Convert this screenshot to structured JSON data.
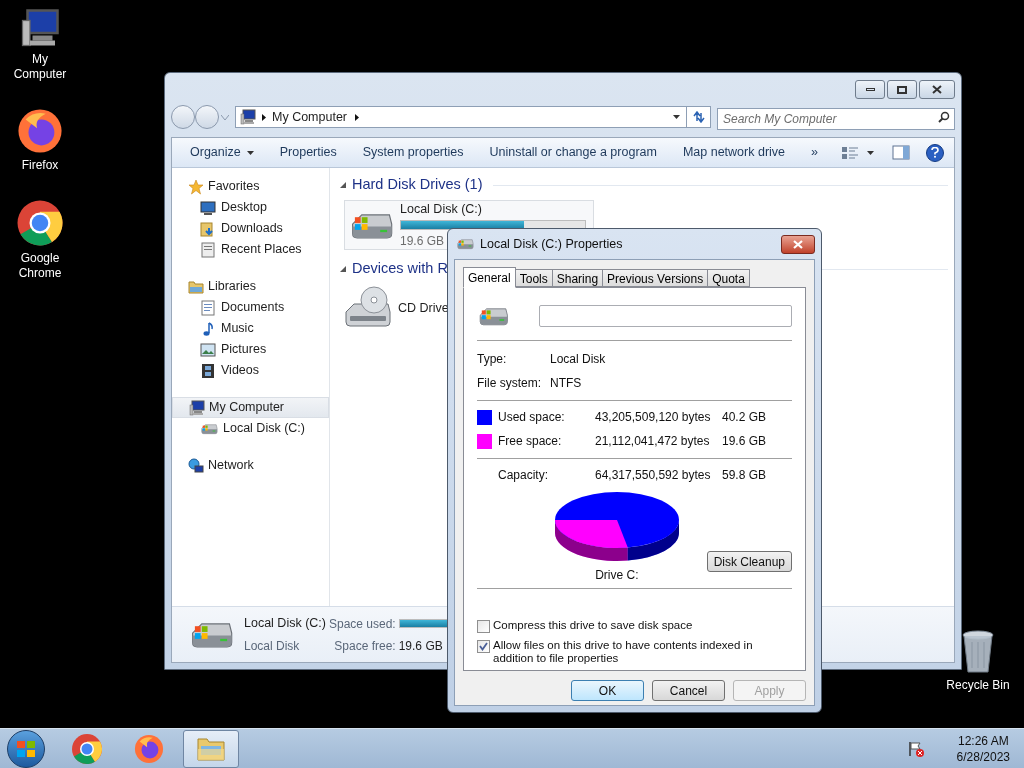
{
  "desktop": {
    "left_icons": [
      {
        "kind": "computer",
        "label": "My Computer"
      },
      {
        "kind": "firefox",
        "label": "Firefox"
      },
      {
        "kind": "chrome",
        "label": "Google Chrome"
      }
    ],
    "right_icons": [
      {
        "kind": "recycle-bin",
        "label": "Recycle Bin"
      }
    ]
  },
  "explorer": {
    "address": {
      "crumbs": [
        "My Computer"
      ]
    },
    "search": {
      "placeholder": "Search My Computer"
    },
    "toolbar": [
      {
        "kind": "menu",
        "label": "Organize"
      },
      {
        "kind": "plain",
        "label": "Properties"
      },
      {
        "kind": "plain",
        "label": "System properties"
      },
      {
        "kind": "plain",
        "label": "Uninstall or change a program"
      },
      {
        "kind": "plain",
        "label": "Map network drive"
      },
      {
        "kind": "plain",
        "label": "»"
      }
    ],
    "sidebar": [
      {
        "kind": "favorites",
        "label": "Favorites",
        "selected": false,
        "children": [
          {
            "kind": "desktop",
            "label": "Desktop",
            "selected": false
          },
          {
            "kind": "downloads",
            "label": "Downloads",
            "selected": false
          },
          {
            "kind": "recent",
            "label": "Recent Places",
            "selected": false
          }
        ]
      },
      {
        "kind": "libraries",
        "label": "Libraries",
        "selected": false,
        "children": [
          {
            "kind": "documents",
            "label": "Documents",
            "selected": false
          },
          {
            "kind": "music",
            "label": "Music",
            "selected": false
          },
          {
            "kind": "pictures",
            "label": "Pictures",
            "selected": false
          },
          {
            "kind": "videos",
            "label": "Videos",
            "selected": false
          }
        ]
      },
      {
        "kind": "computer",
        "label": "My Computer",
        "selected": true,
        "children": [
          {
            "kind": "drive",
            "label": "Local Disk (C:)",
            "selected": false
          }
        ]
      },
      {
        "kind": "network",
        "label": "Network",
        "selected": false
      }
    ],
    "groups": [
      {
        "title": "Hard Disk Drives (1)",
        "items": [
          {
            "kind": "drive",
            "name": "Local Disk (C:)",
            "level": 0.67,
            "free": "19.6 GB"
          }
        ]
      },
      {
        "title": "Devices with R",
        "items": [
          {
            "kind": "cd",
            "name": "CD Drive"
          }
        ]
      }
    ],
    "details": {
      "name": "Local Disk (C:)",
      "type": "Local Disk",
      "used_label": "Space used:",
      "free_label": "Space free:",
      "free": "19.6 GB"
    }
  },
  "dialog": {
    "title": "Local Disk (C:) Properties",
    "tabs": [
      {
        "label": "General",
        "selected": true
      },
      {
        "label": "Tools",
        "selected": false
      },
      {
        "label": "Sharing",
        "selected": false
      },
      {
        "label": "Previous Versions",
        "selected": false
      },
      {
        "label": "Quota",
        "selected": false
      }
    ],
    "info": [
      {
        "label": "Type:",
        "value": "Local Disk"
      },
      {
        "label": "File system:",
        "value": "NTFS"
      }
    ],
    "space": [
      {
        "label": "Used space:",
        "bytes": "43,205,509,120 bytes",
        "size": "40.2 GB",
        "color": "#0000ff"
      },
      {
        "label": "Free space:",
        "bytes": "21,112,041,472 bytes",
        "size": "19.6 GB",
        "color": "#ff00ff"
      }
    ],
    "capacity": {
      "label": "Capacity:",
      "bytes": "64,317,550,592 bytes",
      "size": "59.8 GB"
    },
    "drive_label": "Drive C:",
    "cleanup": "Disk Cleanup",
    "options": [
      {
        "label": "Compress this drive to save disk space",
        "checked": false
      },
      {
        "label": "Allow files on this drive to have contents indexed in addition to file properties",
        "checked": true
      }
    ],
    "buttons": [
      {
        "label": "OK",
        "default": true,
        "disabled": false
      },
      {
        "label": "Cancel",
        "default": false,
        "disabled": false
      },
      {
        "label": "Apply",
        "default": false,
        "disabled": true
      }
    ]
  },
  "taskbar": {
    "items": [
      {
        "kind": "chrome",
        "selected": false
      },
      {
        "kind": "firefox",
        "selected": false
      },
      {
        "kind": "explorer",
        "selected": true
      }
    ],
    "time": "12:26 AM",
    "date": "6/28/2023"
  }
}
